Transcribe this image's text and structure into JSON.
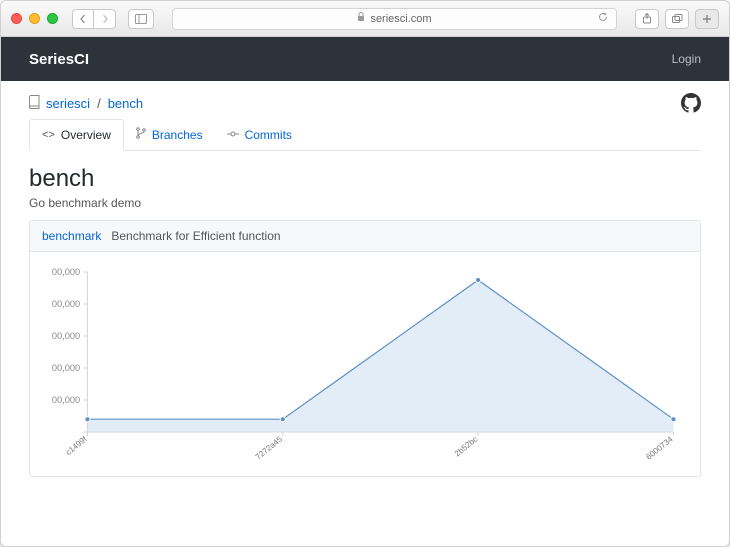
{
  "browser": {
    "address": "seriesci.com"
  },
  "header": {
    "brand": "SeriesCI",
    "login": "Login"
  },
  "breadcrumb": {
    "owner": "seriesci",
    "sep": "/",
    "repo": "bench"
  },
  "tabs": [
    {
      "label": "Overview",
      "active": true
    },
    {
      "label": "Branches",
      "active": false
    },
    {
      "label": "Commits",
      "active": false
    }
  ],
  "page": {
    "title": "bench",
    "description": "Go benchmark demo"
  },
  "panel": {
    "series_name": "benchmark",
    "subtitle": "Benchmark for Efficient function"
  },
  "chart_data": {
    "type": "area",
    "title": "",
    "xlabel": "",
    "ylabel": "",
    "ylim": [
      0,
      100000
    ],
    "yticks": [
      0,
      20000,
      40000,
      60000,
      80000,
      100000
    ],
    "ytick_labels": [
      "",
      "00,000",
      "00,000",
      "00,000",
      "00,000",
      "00,000"
    ],
    "categories": [
      "c1499f",
      "7272a45",
      "2b52bc",
      "6000734"
    ],
    "series": [
      {
        "name": "benchmark",
        "values": [
          8000,
          8000,
          95000,
          8000
        ]
      }
    ]
  }
}
